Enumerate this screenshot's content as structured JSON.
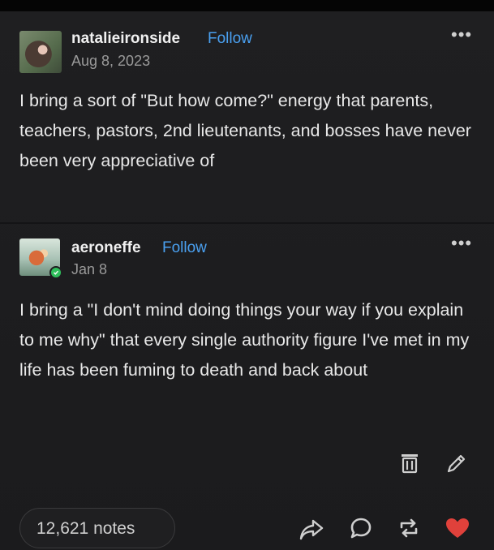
{
  "post1": {
    "username": "natalieironside",
    "follow_label": "Follow",
    "date": "Aug 8, 2023",
    "more_label": "•••",
    "text": "I bring a sort of \"But how come?\" energy that parents, teachers, pastors, 2nd lieutenants, and bosses have never been very appreciative of"
  },
  "post2": {
    "username": "aeroneffe",
    "follow_label": "Follow",
    "date": "Jan 8",
    "more_label": "•••",
    "text": "I bring a \"I don't mind doing things your way if you explain to me why\" that every single authority figure I've met in my life has been fuming to death and back about"
  },
  "footer": {
    "notes": "12,621 notes"
  },
  "icons": {
    "trash": "trash-icon",
    "edit": "pencil-icon",
    "share": "share-icon",
    "reply": "reply-icon",
    "reblog": "reblog-icon",
    "like": "heart-icon"
  },
  "colors": {
    "background": "#1e1e20",
    "follow": "#4aa0f0",
    "like": "#e0413b",
    "online": "#2fbf5b"
  }
}
